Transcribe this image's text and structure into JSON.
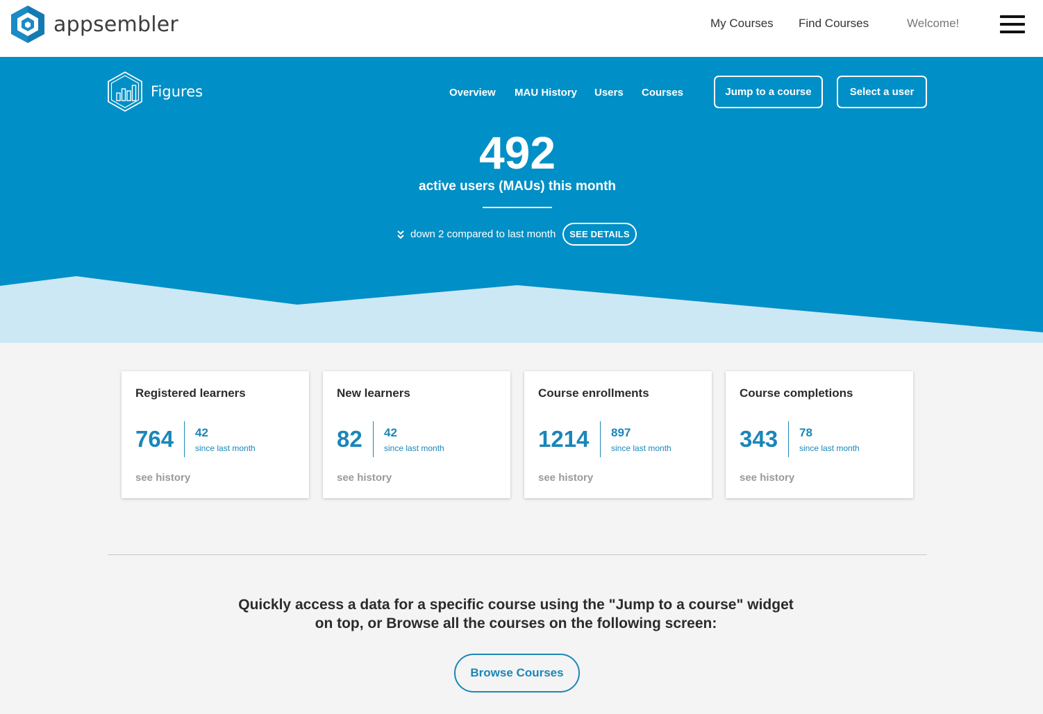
{
  "header": {
    "brand_name": "appsembler",
    "logo_icon": "appsembler-hexagon-logo-icon",
    "nav": [
      {
        "label": "My Courses"
      },
      {
        "label": "Find Courses"
      }
    ],
    "welcome": "Welcome!",
    "menu_icon": "hamburger-menu-icon"
  },
  "figures": {
    "brand_name": "Figures",
    "logo_icon": "figures-bar-chart-hexagon-icon",
    "nav": [
      {
        "label": "Overview"
      },
      {
        "label": "MAU History"
      },
      {
        "label": "Users"
      },
      {
        "label": "Courses"
      }
    ],
    "jump_button": "Jump to a course",
    "select_user_button": "Select a user"
  },
  "mau": {
    "value": "492",
    "label": "active users (MAUs) this month",
    "trend_icon": "double-chevron-down-icon",
    "trend_text": "down 2 compared to last month",
    "details_button": "SEE DETAILS"
  },
  "cards": [
    {
      "title": "Registered learners",
      "value": "764",
      "delta": "42",
      "delta_label": "since last month",
      "history": "see history"
    },
    {
      "title": "New learners",
      "value": "82",
      "delta": "42",
      "delta_label": "since last month",
      "history": "see history"
    },
    {
      "title": "Course enrollments",
      "value": "1214",
      "delta": "897",
      "delta_label": "since last month",
      "history": "see history"
    },
    {
      "title": "Course completions",
      "value": "343",
      "delta": "78",
      "delta_label": "since last month",
      "history": "see history"
    }
  ],
  "browse": {
    "line1": "Quickly access a data for a specific course using the \"Jump to a course\" widget",
    "line2": "on top, or Browse all the courses on the following screen:",
    "button": "Browse Courses"
  },
  "colors": {
    "hero_blue": "#008fc6",
    "wave_light": "#cce8f4",
    "accent": "#1a86b8",
    "page_bg": "#f4f4f4"
  }
}
